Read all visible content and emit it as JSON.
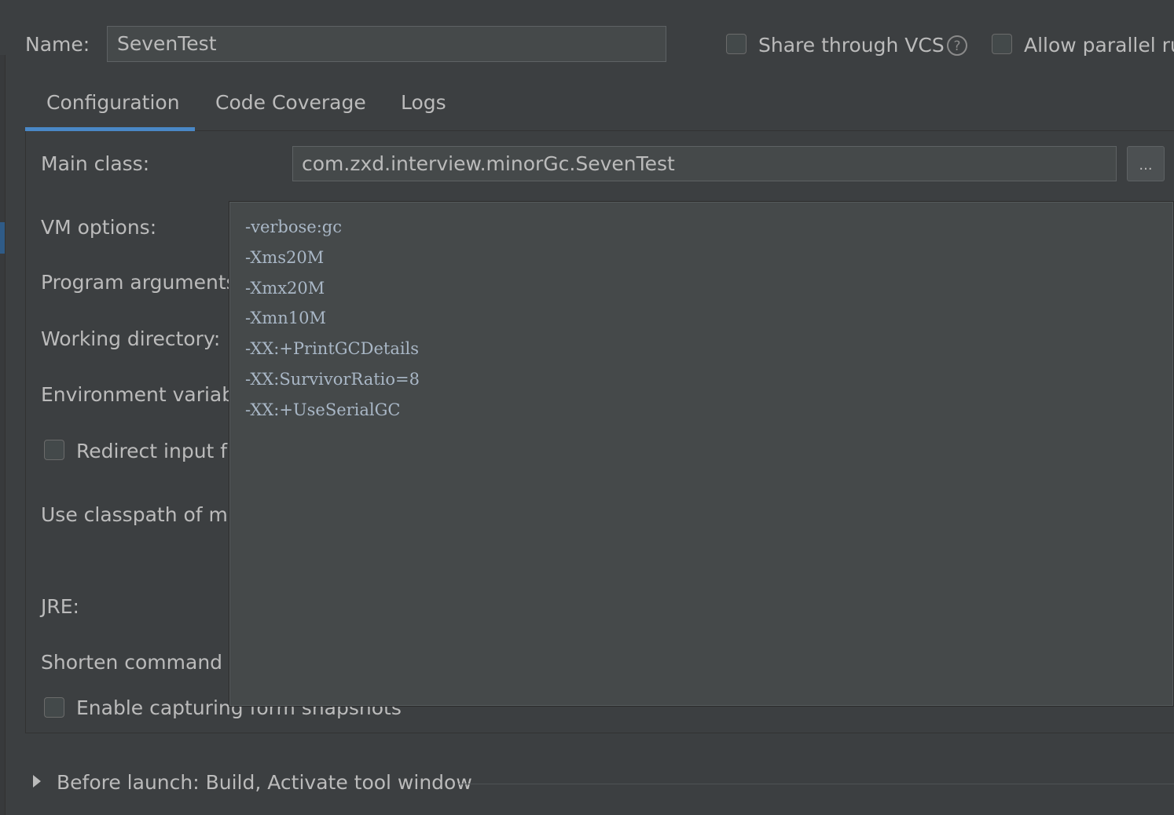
{
  "header": {
    "name_label": "Name:",
    "name_value": "SevenTest",
    "share_vcs_label": "Share through VCS",
    "allow_parallel_label": "Allow parallel ru"
  },
  "tabs": [
    {
      "label": "Configuration",
      "active": true
    },
    {
      "label": "Code Coverage",
      "active": false
    },
    {
      "label": "Logs",
      "active": false
    }
  ],
  "form": {
    "main_class_label": "Main class:",
    "main_class_value": "com.zxd.interview.minorGc.SevenTest",
    "browse_label": "...",
    "vm_options_label": "VM options:",
    "program_arguments_label": "Program arguments:",
    "working_directory_label": "Working directory:",
    "environment_variables_label": "Environment variable",
    "redirect_input_label": "Redirect input fr",
    "use_classpath_label": "Use classpath of mo",
    "jre_label": "JRE:",
    "shorten_command_label": "Shorten command li",
    "enable_capturing_label": "Enable capturing form snapshots"
  },
  "vm_options_popup": {
    "lines": [
      "-verbose:gc",
      "-Xms20M",
      "-Xmx20M",
      "-Xmn10M",
      "-XX:+PrintGCDetails",
      "-XX:SurvivorRatio=8",
      "-XX:+UseSerialGC"
    ]
  },
  "before_launch": {
    "label": "Before launch: Build, Activate tool window"
  },
  "colors": {
    "background": "#3c3f41",
    "input_background": "#45494a",
    "accent": "#4a88c7",
    "text": "#bbbbbb"
  }
}
